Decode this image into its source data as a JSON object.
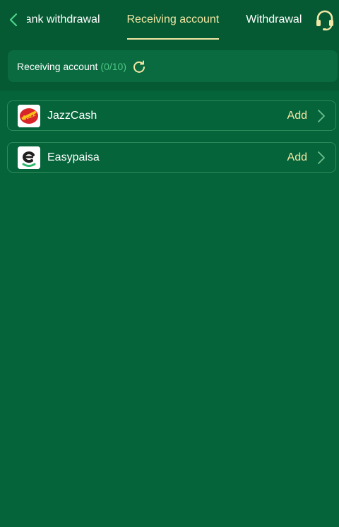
{
  "tabs": [
    {
      "label": "Bank withdrawal",
      "active": false
    },
    {
      "label": "Receiving account",
      "active": true
    },
    {
      "label": "Withdrawal history",
      "active": false
    }
  ],
  "account": {
    "title": "Receiving account",
    "count": "(0/10)"
  },
  "methods": [
    {
      "name": "JazzCash",
      "action": "Add",
      "icon": "jazzcash-logo"
    },
    {
      "name": "Easypaisa",
      "action": "Add",
      "icon": "easypaisa-logo"
    }
  ],
  "colors": {
    "background": "#05643a",
    "accent": "#f3e7a5",
    "count": "#4fc583"
  }
}
